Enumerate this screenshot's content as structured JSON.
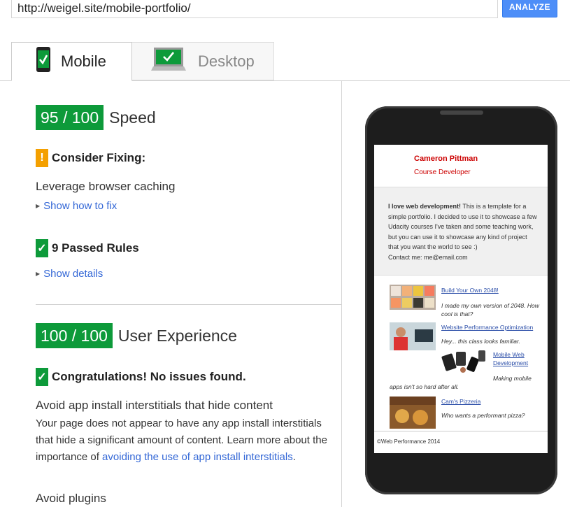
{
  "url_input": {
    "value": "http://weigel.site/mobile-portfolio/"
  },
  "analyze_label": "ANALYZE",
  "tabs": [
    {
      "label": "Mobile",
      "active": true
    },
    {
      "label": "Desktop",
      "active": false
    }
  ],
  "speed": {
    "score": "95 / 100",
    "label": "Speed",
    "consider_fixing": "Consider Fixing:",
    "fix_rule": "Leverage browser caching",
    "show_how": "Show how to fix",
    "passed_rules": "9 Passed Rules",
    "show_details": "Show details"
  },
  "ux": {
    "score": "100 / 100",
    "label": "User Experience",
    "congrats": "Congratulations! No issues found.",
    "rule1_title": "Avoid app install interstitials that hide content",
    "rule1_text": "Your page does not appear to have any app install interstitials that hide a significant amount of content. Learn more about the importance of ",
    "rule1_link": "avoiding the use of app install interstitials",
    "rule1_end": ".",
    "rule2_title": "Avoid plugins"
  },
  "preview": {
    "name": "Cameron Pittman",
    "role": "Course Developer",
    "intro_bold": "I love web development!",
    "intro_rest": " This is a template for a simple portfolio. I decided to use it to showcase a few Udacity courses I've taken and some teaching work, but you can use it to showcase any kind of project that you want the world to see :)",
    "contact": "Contact me: me@email.com",
    "projects": [
      {
        "title": "Build Your Own 2048!",
        "desc": "I made my own version of 2048. How cool is that?"
      },
      {
        "title": "Website Performance Optimization",
        "desc": "Hey... this class looks familiar."
      },
      {
        "title": "Mobile Web Development",
        "desc": "Making mobile apps isn't so hard after all."
      },
      {
        "title": "Cam's Pizzeria",
        "desc": "Who wants a performant pizza?"
      }
    ],
    "footer": "©Web Performance 2014"
  },
  "colors": {
    "pass": "#0d9a3a",
    "warn": "#f4a000",
    "link": "#3367d6",
    "analyze": "#4d8ef8"
  }
}
